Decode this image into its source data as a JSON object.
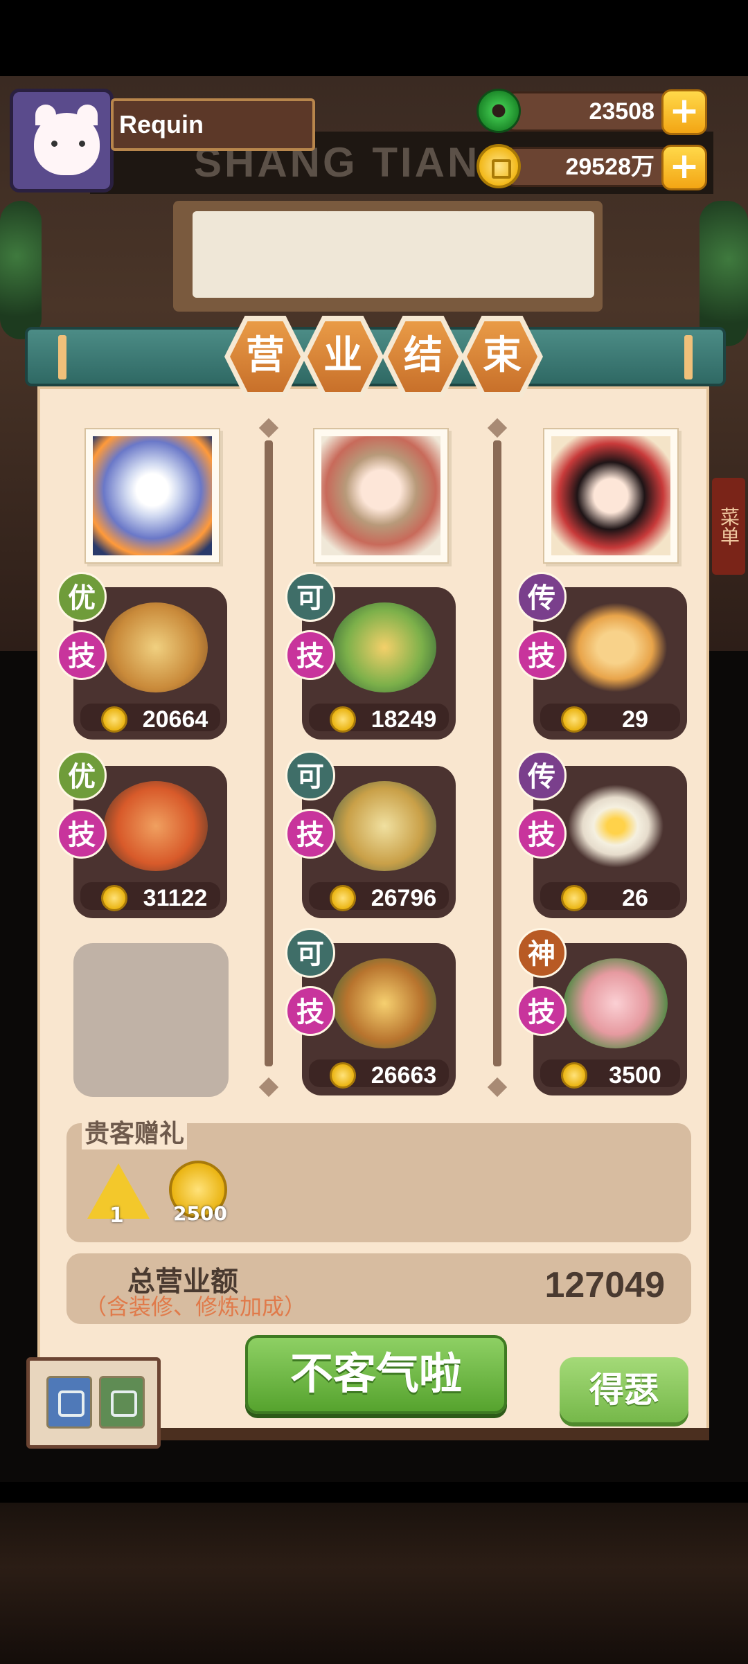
{
  "player": {
    "name": "Requin"
  },
  "currency": {
    "jade": "23508",
    "coins": "29528万",
    "plus": "+"
  },
  "title": [
    "营",
    "业",
    "结",
    "束"
  ],
  "columns": [
    {
      "dishes": [
        {
          "rank": "优",
          "skill": "技",
          "price": "20664",
          "color": "#c98a3a"
        },
        {
          "rank": "优",
          "skill": "技",
          "price": "31122",
          "color": "#d85a2a"
        }
      ]
    },
    {
      "dishes": [
        {
          "rank": "可",
          "skill": "技",
          "price": "18249",
          "color": "#7cb04a"
        },
        {
          "rank": "可",
          "skill": "技",
          "price": "26796",
          "color": "#c9a048"
        },
        {
          "rank": "可",
          "skill": "技",
          "price": "26663",
          "color": "#b8742e"
        }
      ]
    },
    {
      "dishes": [
        {
          "rank": "传",
          "skill": "技",
          "price": "29",
          "color": "#e8a44a"
        },
        {
          "rank": "传",
          "skill": "技",
          "price": "26",
          "color": "#f5f0e0"
        },
        {
          "rank": "神",
          "skill": "技",
          "price": "3500",
          "color": "#e69aa0"
        }
      ]
    }
  ],
  "gift": {
    "title": "贵客赠礼",
    "item_count": "1",
    "coin_amount": "2500"
  },
  "total": {
    "label": "总营业额",
    "sublabel": "（含装修、修炼加成）",
    "value": "127049"
  },
  "buttons": {
    "confirm": "不客气啦",
    "share": "得瑟"
  },
  "bg_menu": "菜单"
}
